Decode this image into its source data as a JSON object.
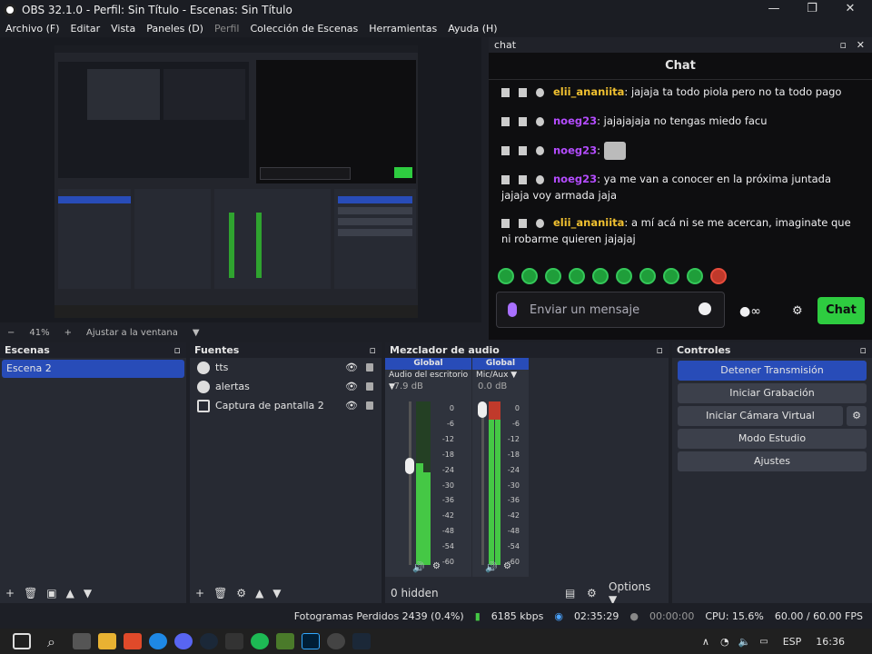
{
  "window": {
    "title": "OBS 32.1.0 - Perfil: Sin Título - Escenas: Sin Título"
  },
  "menu": [
    {
      "label": "Archivo (F)",
      "disabled": false
    },
    {
      "label": "Editar",
      "disabled": false
    },
    {
      "label": "Vista",
      "disabled": false
    },
    {
      "label": "Paneles (D)",
      "disabled": false
    },
    {
      "label": "Perfil",
      "disabled": true
    },
    {
      "label": "Colección de Escenas",
      "disabled": false
    },
    {
      "label": "Herramientas",
      "disabled": false
    },
    {
      "label": "Ayuda (H)",
      "disabled": false
    }
  ],
  "zoom": {
    "minus": "−",
    "value": "41%",
    "plus": "+",
    "fit": "Ajustar a la ventana"
  },
  "chat": {
    "dock_title": "chat",
    "header": "Chat",
    "messages": [
      {
        "user": "elii_ananiita",
        "user_color": "#f0c030",
        "text": ": jajaja ta todo piola pero no ta todo pago"
      },
      {
        "user": "noeg23",
        "user_color": "#b44cff",
        "text": ": jajajajaja no tengas miedo facu"
      },
      {
        "user": "noeg23",
        "user_color": "#b44cff",
        "text": ":"
      },
      {
        "user": "noeg23",
        "user_color": "#b44cff",
        "text": ": ya me van a conocer en la próxima juntada jajaja voy armada jaja"
      },
      {
        "user": "elii_ananiita",
        "user_color": "#f0c030",
        "text": ": a mí acá ni se me acercan, imaginate que ni robarme quieren jajajaj"
      }
    ],
    "input_placeholder": "Enviar un mensaje",
    "send_label": "Chat"
  },
  "scenes": {
    "title": "Escenas",
    "items": [
      "Escena 2"
    ]
  },
  "sources": {
    "title": "Fuentes",
    "items": [
      "tts",
      "alertas",
      "Captura de pantalla 2"
    ]
  },
  "mixer": {
    "title": "Mezclador de audio",
    "channels": [
      {
        "scope": "Global",
        "name": "Audio del escritorio",
        "db": "-7.9 dB",
        "level": 0.62
      },
      {
        "scope": "Global",
        "name": "Mic/Aux",
        "db": "0.0 dB",
        "level": 0.95
      }
    ],
    "scale": [
      "0",
      "-6",
      "-12",
      "-18",
      "-24",
      "-30",
      "-36",
      "-42",
      "-48",
      "-54",
      "-60"
    ],
    "hidden_label": "0 hidden",
    "options_label": "Options"
  },
  "controls": {
    "title": "Controles",
    "buttons": [
      "Detener Transmisión",
      "Iniciar Grabación",
      "Iniciar Cámara Virtual",
      "Modo Estudio",
      "Ajustes"
    ]
  },
  "status": {
    "dropped": "Fotogramas Perdidos 2439 (0.4%)",
    "bitrate": "6185 kbps",
    "stream_time": "02:35:29",
    "rec_time": "00:00:00",
    "cpu": "CPU: 15.6%",
    "fps": "60.00 / 60.00 FPS"
  },
  "taskbar": {
    "lang": "ESP",
    "time": "16:36"
  }
}
